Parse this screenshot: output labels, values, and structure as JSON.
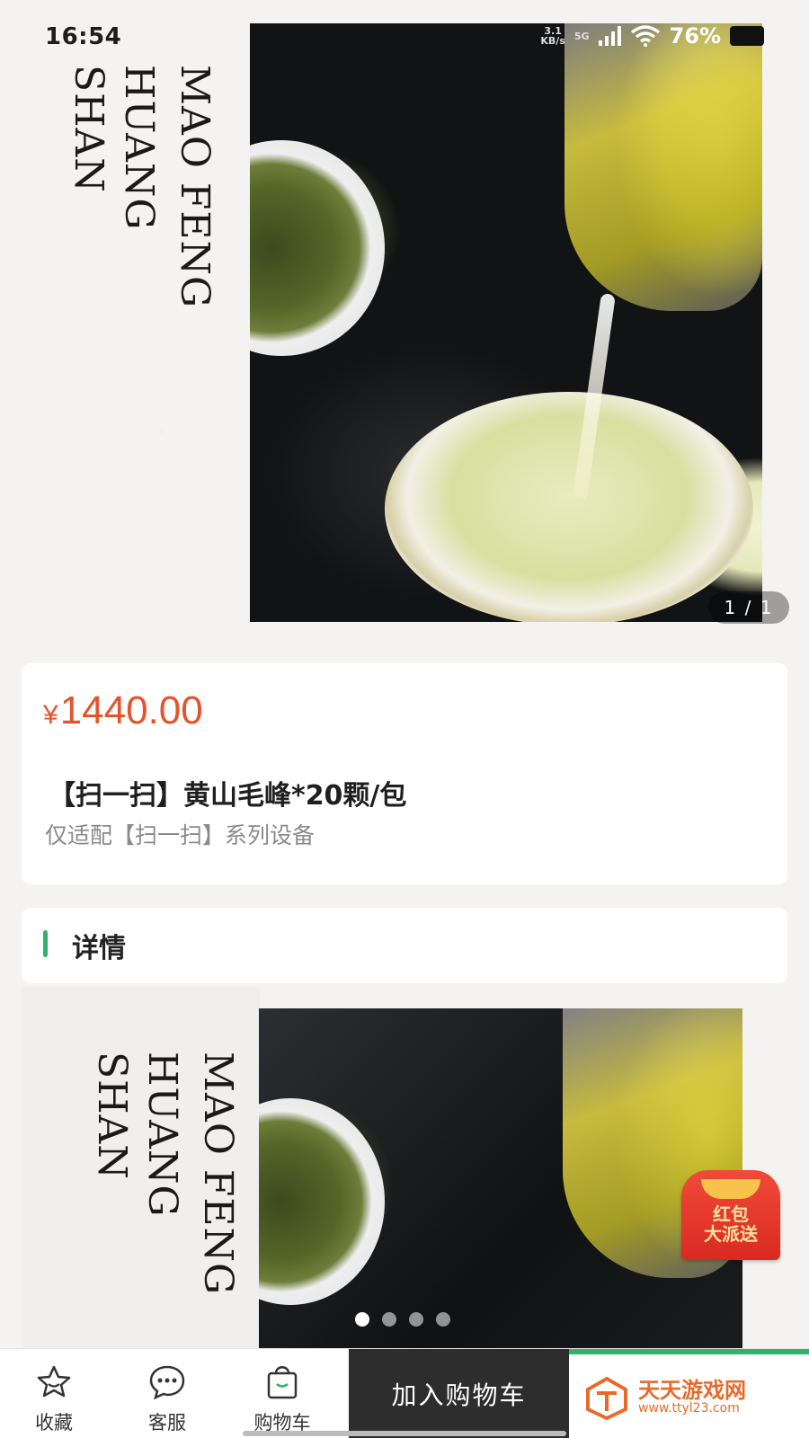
{
  "status_bar": {
    "time": "16:54",
    "network_top": "3.1",
    "network_bottom": "KB/s",
    "network_type": "5G",
    "battery": "76%"
  },
  "hero": {
    "title_line1": "HUANG SHAN",
    "title_line2": "MAO FENG",
    "counter": "1 / 1"
  },
  "product": {
    "currency": "¥",
    "price": "1440.00",
    "title": "【扫一扫】黄山毛峰*20颗/包",
    "subtitle": "仅适配【扫一扫】系列设备",
    "price_color": "#e6532b"
  },
  "detail": {
    "label": "详情",
    "accent_color": "#2fb36b",
    "image_title_line1": "HUANG SHAN",
    "image_title_line2": "MAO FENG",
    "carousel_pages": 4,
    "carousel_active": 1
  },
  "red_packet": {
    "line1": "红包",
    "line2": "大派送"
  },
  "bottom_bar": {
    "favorite_label": "收藏",
    "favorite_icon": "star-icon",
    "service_label": "客服",
    "service_icon": "chat-icon",
    "cart_label": "购物车",
    "cart_icon": "shopping-bag-icon",
    "add_to_cart_label": "加入购物车"
  },
  "watermark": {
    "name": "天天游戏网",
    "url": "www.ttyl23.com"
  }
}
